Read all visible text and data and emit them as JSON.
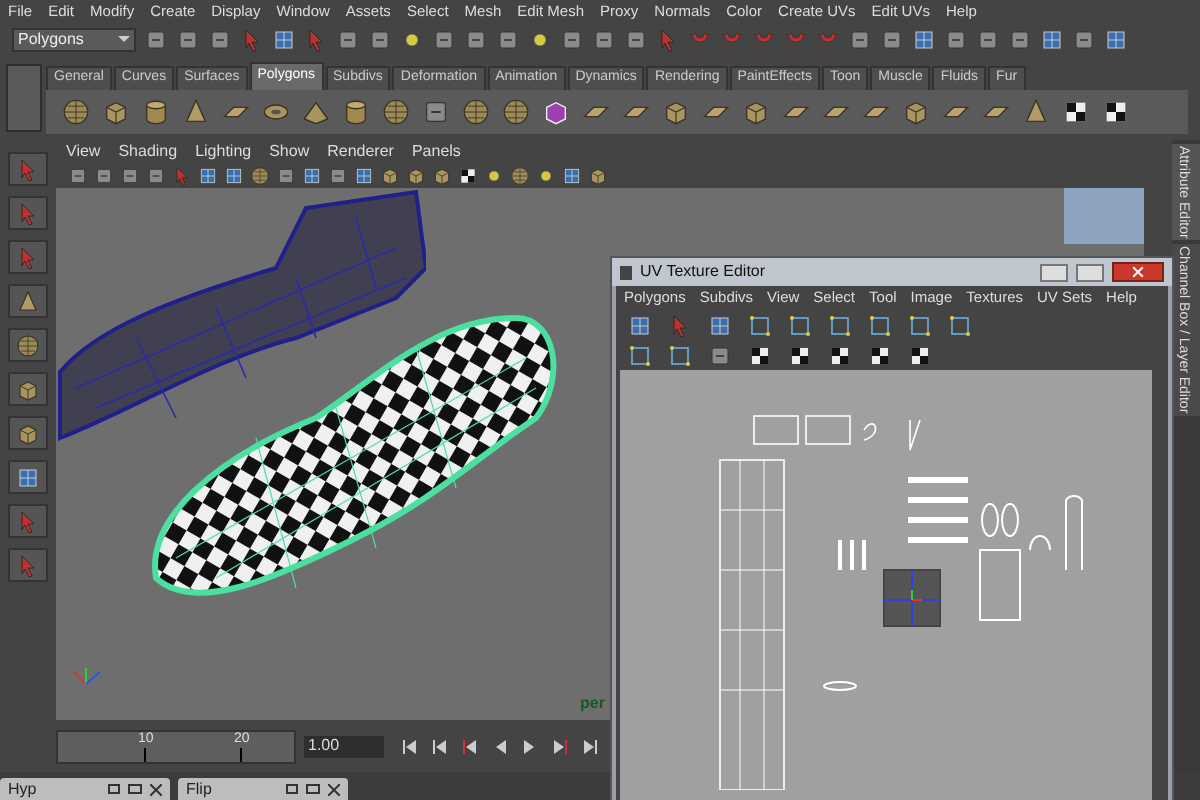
{
  "menu_bar": [
    "File",
    "Edit",
    "Modify",
    "Create",
    "Display",
    "Window",
    "Assets",
    "Select",
    "Mesh",
    "Edit Mesh",
    "Proxy",
    "Normals",
    "Color",
    "Create UVs",
    "Edit UVs",
    "Help"
  ],
  "toolbar": {
    "mode": "Polygons"
  },
  "shelf_tabs": [
    {
      "label": "General",
      "selected": false
    },
    {
      "label": "Curves",
      "selected": false
    },
    {
      "label": "Surfaces",
      "selected": false
    },
    {
      "label": "Polygons",
      "selected": true
    },
    {
      "label": "Subdivs",
      "selected": false
    },
    {
      "label": "Deformation",
      "selected": false
    },
    {
      "label": "Animation",
      "selected": false
    },
    {
      "label": "Dynamics",
      "selected": false
    },
    {
      "label": "Rendering",
      "selected": false
    },
    {
      "label": "PaintEffects",
      "selected": false
    },
    {
      "label": "Toon",
      "selected": false
    },
    {
      "label": "Muscle",
      "selected": false
    },
    {
      "label": "Fluids",
      "selected": false
    },
    {
      "label": "Fur",
      "selected": false
    }
  ],
  "viewport": {
    "menus": [
      "View",
      "Shading",
      "Lighting",
      "Show",
      "Renderer",
      "Panels"
    ],
    "camera_label": "per"
  },
  "uv_editor": {
    "title": "UV Texture Editor",
    "menus": [
      "Polygons",
      "Subdivs",
      "View",
      "Select",
      "Tool",
      "Image",
      "Textures",
      "UV Sets",
      "Help"
    ]
  },
  "side_tabs": [
    "Attribute Editor",
    "Channel Box / Layer Editor"
  ],
  "timeline": {
    "ticks": [
      "10",
      "20"
    ],
    "current_frame": "1.00"
  },
  "minimized_windows": [
    {
      "title": "Hyp"
    },
    {
      "title": "Flip"
    }
  ]
}
